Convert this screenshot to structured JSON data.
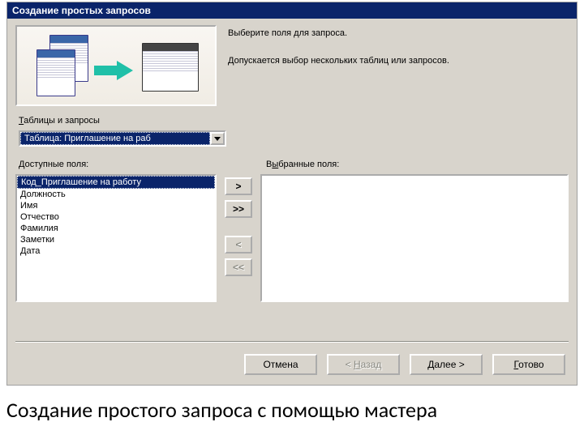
{
  "window": {
    "title": "Создание простых запросов"
  },
  "intro": {
    "line1": "Выберите поля для запроса.",
    "line2": "Допускается выбор нескольких таблиц или запросов."
  },
  "source": {
    "label": "Таблицы и запросы",
    "selected": "Таблица: Приглашение на раб"
  },
  "available": {
    "label": "Доступные поля:",
    "items": [
      "Код_Приглашение на работу",
      "Должность",
      "Имя",
      "Отчество",
      "Фамилия",
      "Заметки",
      "Дата"
    ],
    "selected_index": 0
  },
  "selected_fields": {
    "label": "Выбранные поля:"
  },
  "move": {
    "add": ">",
    "addAll": ">>",
    "remove": "<",
    "removeAll": "<<"
  },
  "buttons": {
    "cancel": "Отмена",
    "back": "< Назад",
    "next": "Далее >",
    "finish": "Готово"
  },
  "caption": "Создание простого запроса с помощью мастера"
}
